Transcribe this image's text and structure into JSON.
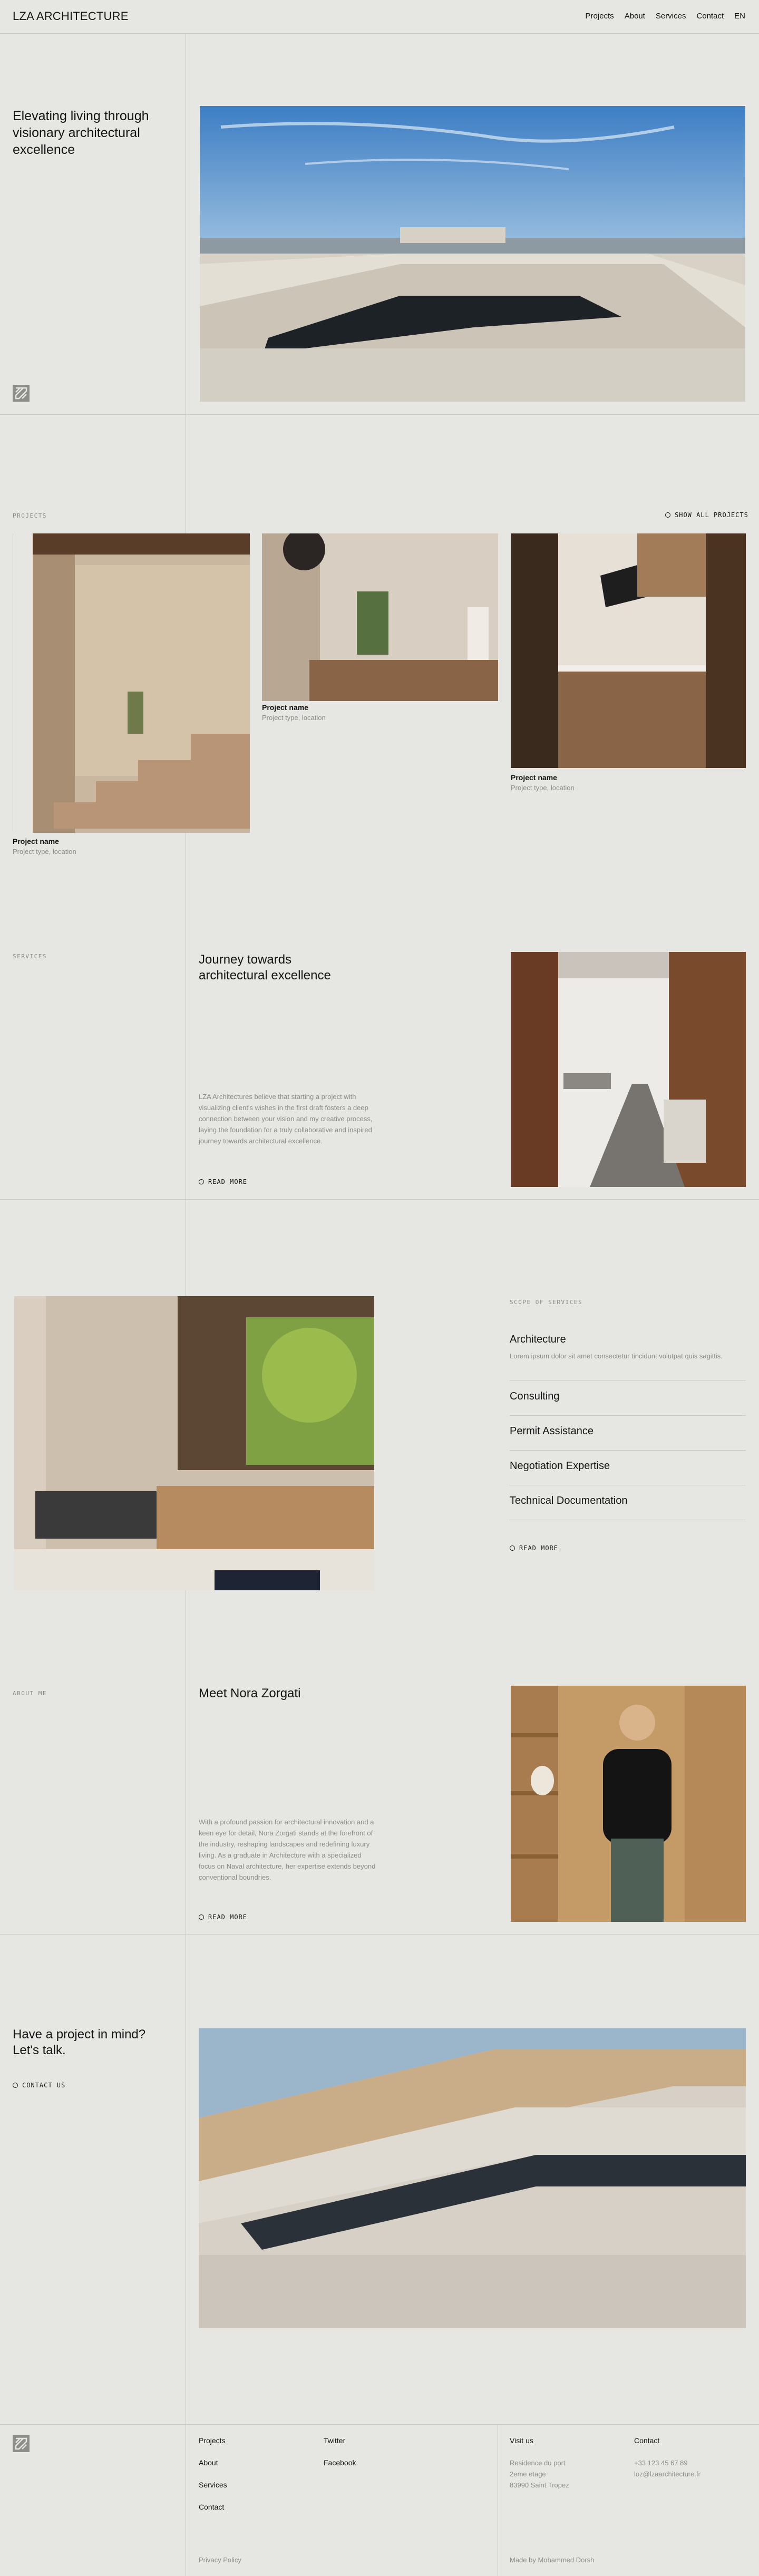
{
  "header": {
    "logo": "LZA ARCHITECTURE",
    "nav": [
      "Projects",
      "About",
      "Services",
      "Contact",
      "EN"
    ]
  },
  "hero": {
    "title": "Elevating living through visionary architectural excellence",
    "image_alt": "mark-icon"
  },
  "projects": {
    "label": "PROJECTS",
    "show_all": "SHOW ALL PROJECTS",
    "items": [
      {
        "name": "Project name",
        "meta": "Project type, location"
      },
      {
        "name": "Project name",
        "meta": "Project type, location"
      },
      {
        "name": "Project name",
        "meta": "Project type, location"
      }
    ]
  },
  "services_intro": {
    "label": "SERVICES",
    "title": "Journey towards architectural excellence",
    "body": "LZA Architectures believe that starting a project with visualizing client's wishes in the first draft fosters a deep connection between your vision and my creative process, laying the foundation for a truly collaborative and inspired journey towards architectural excellence.",
    "cta": "READ MORE"
  },
  "scope": {
    "label": "SCOPE OF SERVICES",
    "items": [
      {
        "title": "Architecture",
        "desc": "Lorem ipsum dolor sit amet consectetur tincidunt volutpat quis sagittis."
      },
      {
        "title": "Consulting"
      },
      {
        "title": "Permit Assistance"
      },
      {
        "title": "Negotiation Expertise"
      },
      {
        "title": "Technical Documentation"
      }
    ],
    "cta": "READ MORE"
  },
  "about": {
    "label": "ABOUT ME",
    "title": "Meet Nora Zorgati",
    "body": "With a profound passion for architectural innovation and a keen eye for detail, Nora Zorgati stands at the forefront of the industry, reshaping landscapes and redefining luxury living. As a graduate in Architecture with a specialized focus on Naval architecture, her expertise extends beyond conventional boundries.",
    "cta": "READ MORE"
  },
  "contact_cta": {
    "title": "Have a project in mind? Let's talk.",
    "cta": "CONTACT US"
  },
  "footer": {
    "col1": [
      "Projects",
      "About",
      "Services",
      "Contact"
    ],
    "col2": [
      "Twitter",
      "Facebook"
    ],
    "visit_label": "Visit us",
    "visit_lines": [
      "Residence du port",
      "2eme etage",
      "83990 Saint Tropez"
    ],
    "contact_label": "Contact",
    "contact_lines": [
      "+33 123 45 67 89",
      "loz@lzaarchitecture.fr"
    ],
    "privacy": "Privacy Policy",
    "made_by": "Made by Mohammed Dorsh"
  },
  "colors": {
    "background": "#e6e6e2",
    "text": "#141414",
    "muted": "#8c8c87",
    "rule": "#c9c9c4"
  }
}
